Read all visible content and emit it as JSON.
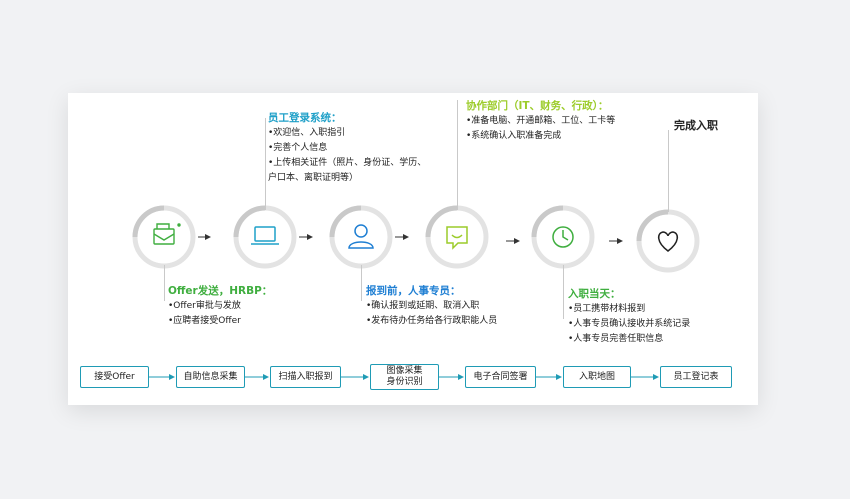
{
  "steps": [
    {
      "icon": "email-icon",
      "color": "#3fae3f",
      "title": "Offer发送，HRBP：",
      "items": [
        "•Offer审批与发放",
        "•应聘者接受Offer"
      ]
    },
    {
      "icon": "laptop-icon",
      "color": "#1fa0c8",
      "title": "员工登录系统：",
      "items": [
        "•欢迎信、入职指引",
        "•完善个人信息",
        "•上传相关证件（照片、身份证、学历、",
        "户口本、离职证明等）"
      ]
    },
    {
      "icon": "user-icon",
      "color": "#1f7fd3",
      "title": "报到前，人事专员：",
      "items": [
        "•确认报到或延期、取消入职",
        "•发布待办任务给各行政职能人员"
      ]
    },
    {
      "icon": "chat-icon",
      "color": "#9ccc2a",
      "title": "协作部门（IT、财务、行政）：",
      "items": [
        "•准备电脑、开通邮箱、工位、工卡等",
        "•系统确认入职准备完成"
      ]
    },
    {
      "icon": "clock-icon",
      "color": "#3fae3f",
      "title": "入职当天：",
      "items": [
        "•员工携带材料报到",
        "•人事专员确认接收并系统记录",
        "•人事专员完善任职信息"
      ]
    },
    {
      "icon": "heart-icon",
      "color": "#222222",
      "title": "完成入职",
      "items": []
    }
  ],
  "flow": [
    {
      "line1": "接受Offer",
      "line2": ""
    },
    {
      "line1": "自助信息采集",
      "line2": ""
    },
    {
      "line1": "扫描入职报到",
      "line2": ""
    },
    {
      "line1": "图像采集",
      "line2": "身份识别"
    },
    {
      "line1": "电子合同签署",
      "line2": ""
    },
    {
      "line1": "入职地图",
      "line2": ""
    },
    {
      "line1": "员工登记表",
      "line2": ""
    }
  ],
  "colors": {
    "accent_teal": "#1f9bb5",
    "green": "#3fae3f",
    "blue": "#1f7fd3",
    "lime": "#9ccc2a"
  }
}
